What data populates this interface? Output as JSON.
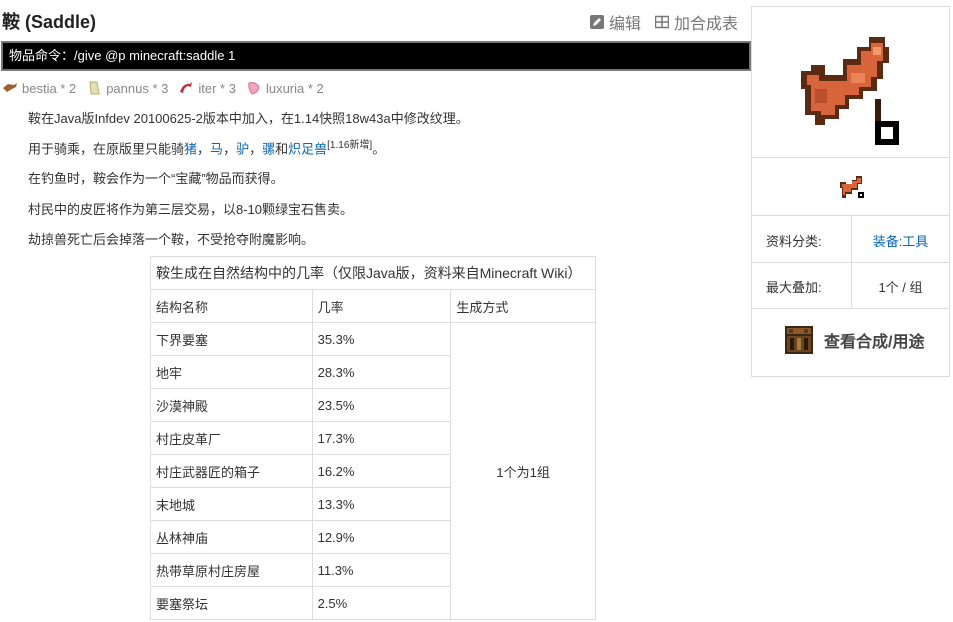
{
  "page": {
    "title": "鞍 (Saddle)",
    "edit_label": "编辑",
    "add_table_label": "加合成表"
  },
  "command": "物品命令：/give @p minecraft:saddle 1",
  "tags": [
    {
      "icon": "bestia-icon",
      "label": "bestia * 2"
    },
    {
      "icon": "pannus-icon",
      "label": "pannus * 3"
    },
    {
      "icon": "iter-icon",
      "label": "iter * 3"
    },
    {
      "icon": "luxuria-icon",
      "label": "luxuria * 2"
    }
  ],
  "description": {
    "p1": "鞍在Java版Infdev 20100625-2版本中加入，在1.14快照18w43a中修改纹理。",
    "p2": {
      "prefix": "用于骑乘，在原版里只能骑",
      "pig": "猪",
      "sep1": "，",
      "horse": "马",
      "sep2": "，",
      "donkey": "驴",
      "sep3": "，",
      "mule": "骡",
      "and": "和",
      "strider": "炽足兽",
      "note": "[1.16新增]",
      "end": "。"
    },
    "p3": "在钓鱼时，鞍会作为一个“宝藏”物品而获得。",
    "p4": "村民中的皮匠将作为第三层交易，以8-10颗绿宝石售卖。",
    "p5": "劫掠兽死亡后会掉落一个鞍，不受抢夺附魔影响。"
  },
  "loot_table": {
    "caption": "鞍生成在自然结构中的几率（仅限Java版，资料来自Minecraft Wiki）",
    "headers": [
      "结构名称",
      "几率",
      "生成方式"
    ],
    "method": "1个为1组",
    "rows": [
      {
        "name": "下界要塞",
        "chance": "35.3%"
      },
      {
        "name": "地牢",
        "chance": "28.3%"
      },
      {
        "name": "沙漠神殿",
        "chance": "23.5%"
      },
      {
        "name": "村庄皮革厂",
        "chance": "17.3%"
      },
      {
        "name": "村庄武器匠的箱子",
        "chance": "16.2%"
      },
      {
        "name": "末地城",
        "chance": "13.3%"
      },
      {
        "name": "丛林神庙",
        "chance": "12.9%"
      },
      {
        "name": "热带草原村庄房屋",
        "chance": "11.3%"
      },
      {
        "name": "要塞祭坛",
        "chance": "2.5%"
      }
    ]
  },
  "sidebar": {
    "category_label": "资料分类:",
    "category_value": "装备:工具",
    "stack_label": "最大叠加:",
    "stack_value": "1个 / 组",
    "craft_label": "查看合成/用途"
  },
  "colors": {
    "link": "#0b67b2",
    "command_bg": "#000000",
    "saddle_main": "#d8643c",
    "saddle_dark": "#5a2a12"
  }
}
